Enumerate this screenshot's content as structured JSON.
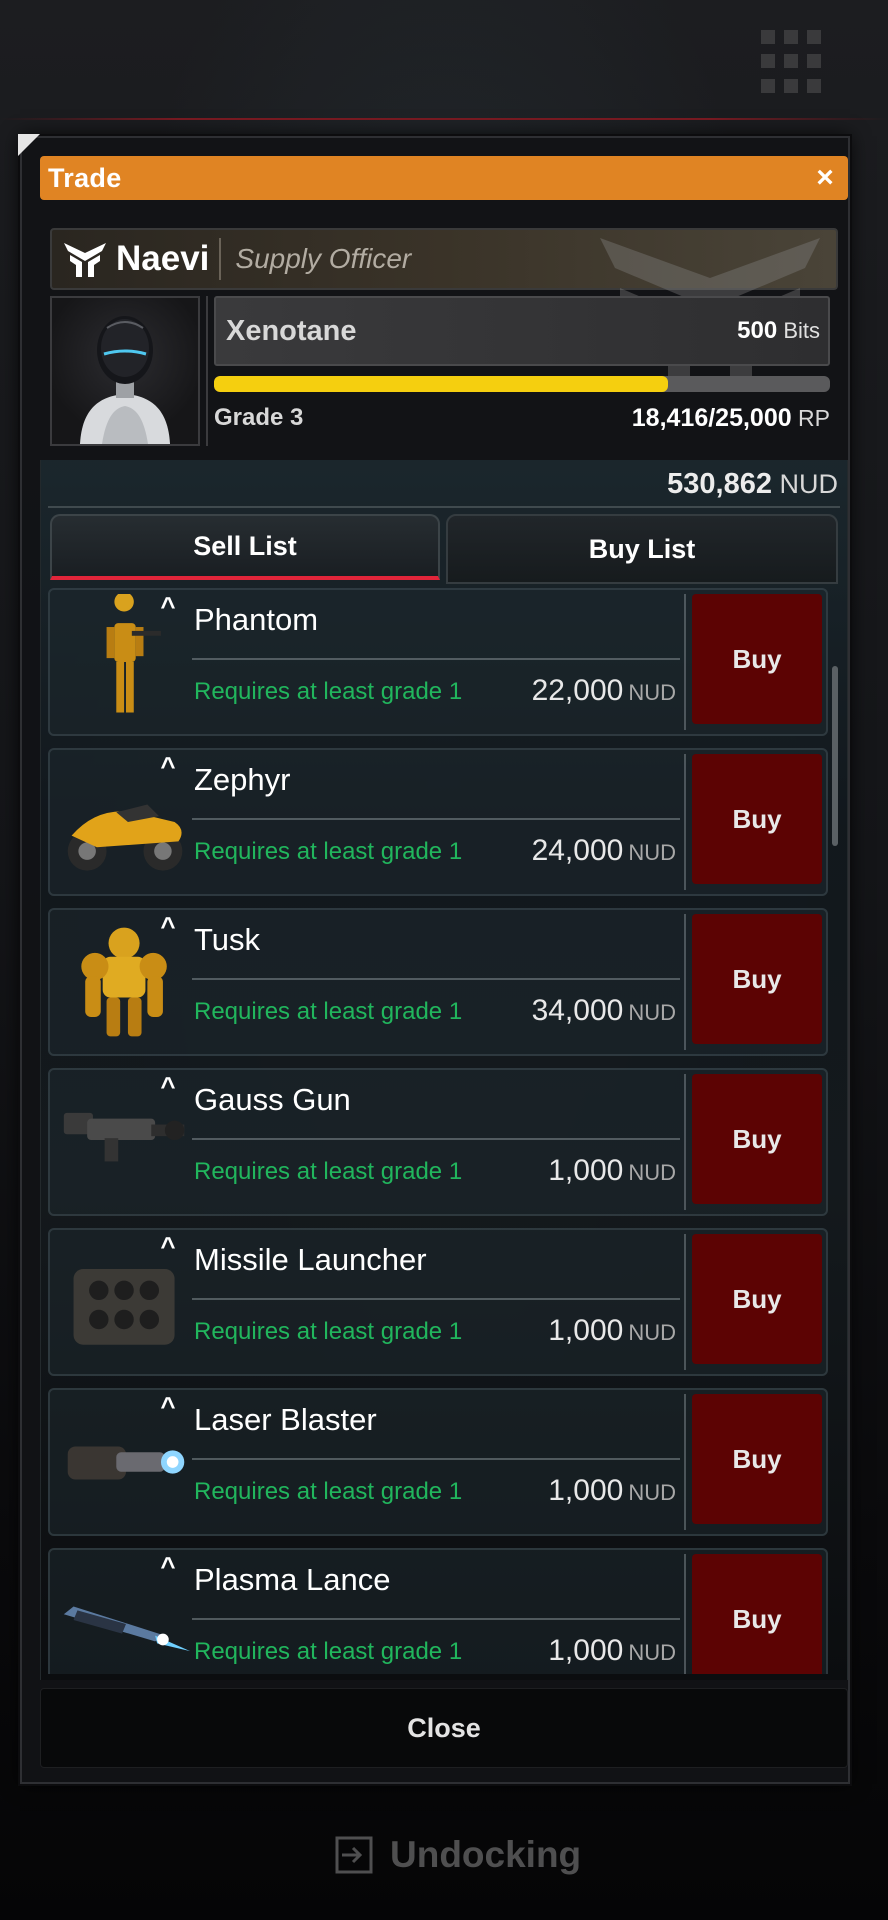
{
  "dialog": {
    "title": "Trade",
    "close_label": "×"
  },
  "officer": {
    "name": "Naevi",
    "role": "Supply Officer"
  },
  "faction": {
    "name": "Xenotane",
    "bits_value": "500",
    "bits_unit": "Bits",
    "grade": "Grade 3",
    "rp_current": "18,416/25,000",
    "rp_unit": "RP",
    "progress": 0.7366
  },
  "balance": {
    "value": "530,862",
    "unit": "NUD"
  },
  "tabs": {
    "sell": "Sell List",
    "buy": "Buy List"
  },
  "items": [
    {
      "name": "Phantom",
      "requirement": "Requires at least grade 1",
      "price": "22,000",
      "unit": "NUD",
      "button": "Buy",
      "icon": "soldier-icon"
    },
    {
      "name": "Zephyr",
      "requirement": "Requires at least grade 1",
      "price": "24,000",
      "unit": "NUD",
      "button": "Buy",
      "icon": "motorbike-icon"
    },
    {
      "name": "Tusk",
      "requirement": "Requires at least grade 1",
      "price": "34,000",
      "unit": "NUD",
      "button": "Buy",
      "icon": "mech-suit-icon"
    },
    {
      "name": "Gauss Gun",
      "requirement": "Requires at least grade 1",
      "price": "1,000",
      "unit": "NUD",
      "button": "Buy",
      "icon": "gun-icon"
    },
    {
      "name": "Missile Launcher",
      "requirement": "Requires at least grade 1",
      "price": "1,000",
      "unit": "NUD",
      "button": "Buy",
      "icon": "missile-launcher-icon"
    },
    {
      "name": "Laser Blaster",
      "requirement": "Requires at least grade 1",
      "price": "1,000",
      "unit": "NUD",
      "button": "Buy",
      "icon": "laser-blaster-icon"
    },
    {
      "name": "Plasma Lance",
      "requirement": "Requires at least grade 1",
      "price": "1,000",
      "unit": "NUD",
      "button": "Buy",
      "icon": "plasma-lance-icon"
    }
  ],
  "footer": {
    "close_label": "Close",
    "undock_label": "Undocking"
  },
  "colors": {
    "title_bar": "#e08423",
    "progress_fill": "#f5cf0f",
    "requirement_text": "#21b65d",
    "buy_button": "#5c0303",
    "tab_underline": "#e2253a"
  }
}
